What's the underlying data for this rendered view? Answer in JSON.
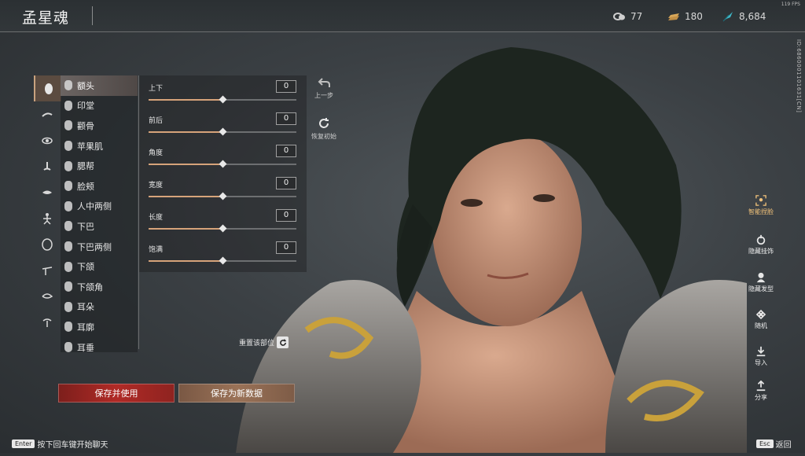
{
  "header": {
    "title": "孟星魂",
    "fps": "119 FPS",
    "currencies": [
      {
        "icon": "coin-pile-icon",
        "value": "77"
      },
      {
        "icon": "gold-ingot-icon",
        "value": "180"
      },
      {
        "icon": "feather-icon",
        "value": "8,684"
      }
    ],
    "player_id": "ID:6860001101631[CN]"
  },
  "sidebar_icons": [
    {
      "icon": "face-icon",
      "active": true
    },
    {
      "icon": "eyebrow-icon"
    },
    {
      "icon": "eye-icon"
    },
    {
      "icon": "nose-icon"
    },
    {
      "icon": "mouth-icon"
    },
    {
      "icon": "body-icon"
    },
    {
      "icon": "head-shape-icon"
    },
    {
      "icon": "hair-icon"
    },
    {
      "icon": "eye-makeup-icon"
    },
    {
      "icon": "lip-makeup-icon"
    }
  ],
  "parts": [
    "额头",
    "印堂",
    "颧骨",
    "苹果肌",
    "腮帮",
    "脸颊",
    "人中两侧",
    "下巴",
    "下巴两侧",
    "下颌",
    "下颌角",
    "耳朵",
    "耳廓",
    "耳垂"
  ],
  "active_part": "额头",
  "sliders": [
    {
      "label": "上下",
      "value": "0",
      "level": 0.5
    },
    {
      "label": "前后",
      "value": "0",
      "level": 0.5
    },
    {
      "label": "角度",
      "value": "0",
      "level": 0.5
    },
    {
      "label": "宽度",
      "value": "0",
      "level": 0.5
    },
    {
      "label": "长度",
      "value": "0",
      "level": 0.5
    },
    {
      "label": "饱满",
      "value": "0",
      "level": 0.5
    }
  ],
  "controls": {
    "undo": "上一步",
    "restore": "恢复初始",
    "reset_part": "重置该部位"
  },
  "buttons": {
    "save_use": "保存并使用",
    "save_new": "保存为新数据"
  },
  "right_menu": [
    "智能捏脸",
    "隐藏挂饰",
    "隐藏发型",
    "随机",
    "导入",
    "分享"
  ],
  "hints": {
    "enter_key": "Enter",
    "enter_text": "按下回车键开始聊天",
    "esc_key": "Esc",
    "esc_text": "返回"
  },
  "colors": {
    "accent": "#d6a37a",
    "save_button": "#b02a26",
    "new_button": "#9a7257",
    "smart_face": "#f2c37a"
  }
}
